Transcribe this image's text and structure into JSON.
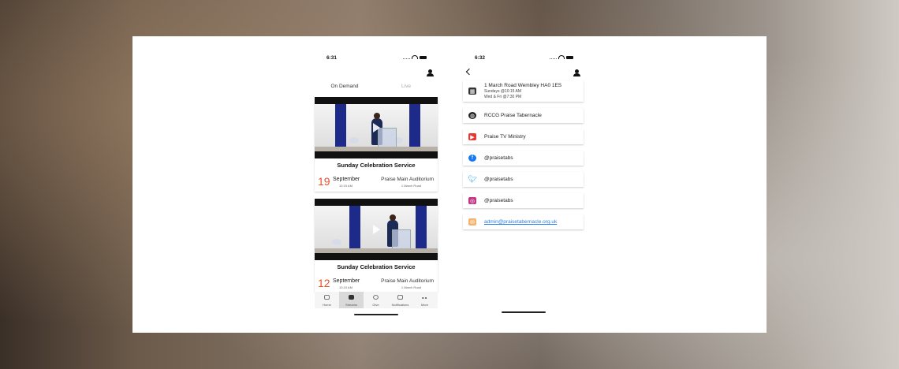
{
  "left_phone": {
    "time": "6:31",
    "tabs": [
      "On Demand",
      "Live"
    ],
    "streams": [
      {
        "title": "Sunday Celebration Service",
        "day": "19",
        "month": "September",
        "time": "10:15 AM",
        "location": "Praise Main Auditorium",
        "address": "1 March Road"
      },
      {
        "title": "Sunday Celebration Service",
        "day": "12",
        "month": "September",
        "time": "10:15 AM",
        "location": "Praise Main Auditorium",
        "address": "1 March Road"
      }
    ],
    "nav": [
      "Home",
      "Streams",
      "Give",
      "Notifications",
      "More"
    ]
  },
  "right_phone": {
    "time": "6:32",
    "address": "1 March Road Wembley HA0 1ES",
    "service_times_1": "Sundays @10:15 AM",
    "service_times_2": "Wed & Fri @7:30 PM",
    "website": "RCCG Praise Tabernacle",
    "youtube": "Praise TV Ministry",
    "facebook": "@praisetabs",
    "twitter": "@praisetabs",
    "instagram": "@praisetabs",
    "email": "admin@praisetabernacle.org.uk"
  },
  "colors": {
    "accent_date": "#e4532b",
    "youtube": "#e53935",
    "facebook": "#1877f2",
    "twitter": "#1da1f2",
    "instagram": "#c13584",
    "link": "#2a7de1"
  }
}
